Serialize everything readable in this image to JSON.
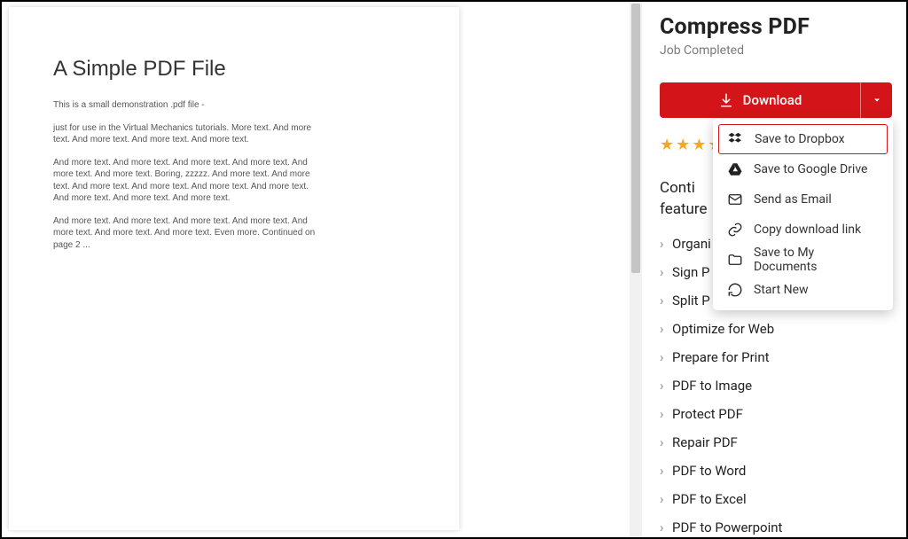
{
  "preview": {
    "title": "A Simple PDF File",
    "p1": "This is a small demonstration .pdf file -",
    "p2": "just for use in the Virtual Mechanics tutorials. More text. And more text. And more text. And more text. And more text.",
    "p3": "And more text. And more text. And more text. And more text. And more text. And more text. Boring, zzzzz. And more text. And more text. And more text. And more text. And more text. And more text. And more text. And more text. And more text.",
    "p4": "And more text. And more text. And more text. And more text. And more text. And more text. And more text. Even more. Continued on page 2 ..."
  },
  "side": {
    "title": "Compress PDF",
    "status": "Job Completed",
    "download_label": "Download",
    "stars": 4,
    "continue_line1": "Conti",
    "continue_line2": "feature",
    "features": [
      "Organi",
      "Sign P",
      "Split P",
      "Optimize for Web",
      "Prepare for Print",
      "PDF to Image",
      "Protect PDF",
      "Repair PDF",
      "PDF to Word",
      "PDF to Excel",
      "PDF to Powerpoint"
    ]
  },
  "dropdown": {
    "items": [
      {
        "label": "Save to Dropbox",
        "icon": "dropbox-icon",
        "highlight": true
      },
      {
        "label": "Save to Google Drive",
        "icon": "gdrive-icon",
        "highlight": false
      },
      {
        "label": "Send as Email",
        "icon": "mail-icon",
        "highlight": false
      },
      {
        "label": "Copy download link",
        "icon": "link-icon",
        "highlight": false
      },
      {
        "label": "Save to My Documents",
        "icon": "folder-icon",
        "highlight": false
      },
      {
        "label": "Start New",
        "icon": "refresh-icon",
        "highlight": false
      }
    ]
  },
  "colors": {
    "accent": "#d3151a",
    "star": "#f5a623"
  }
}
